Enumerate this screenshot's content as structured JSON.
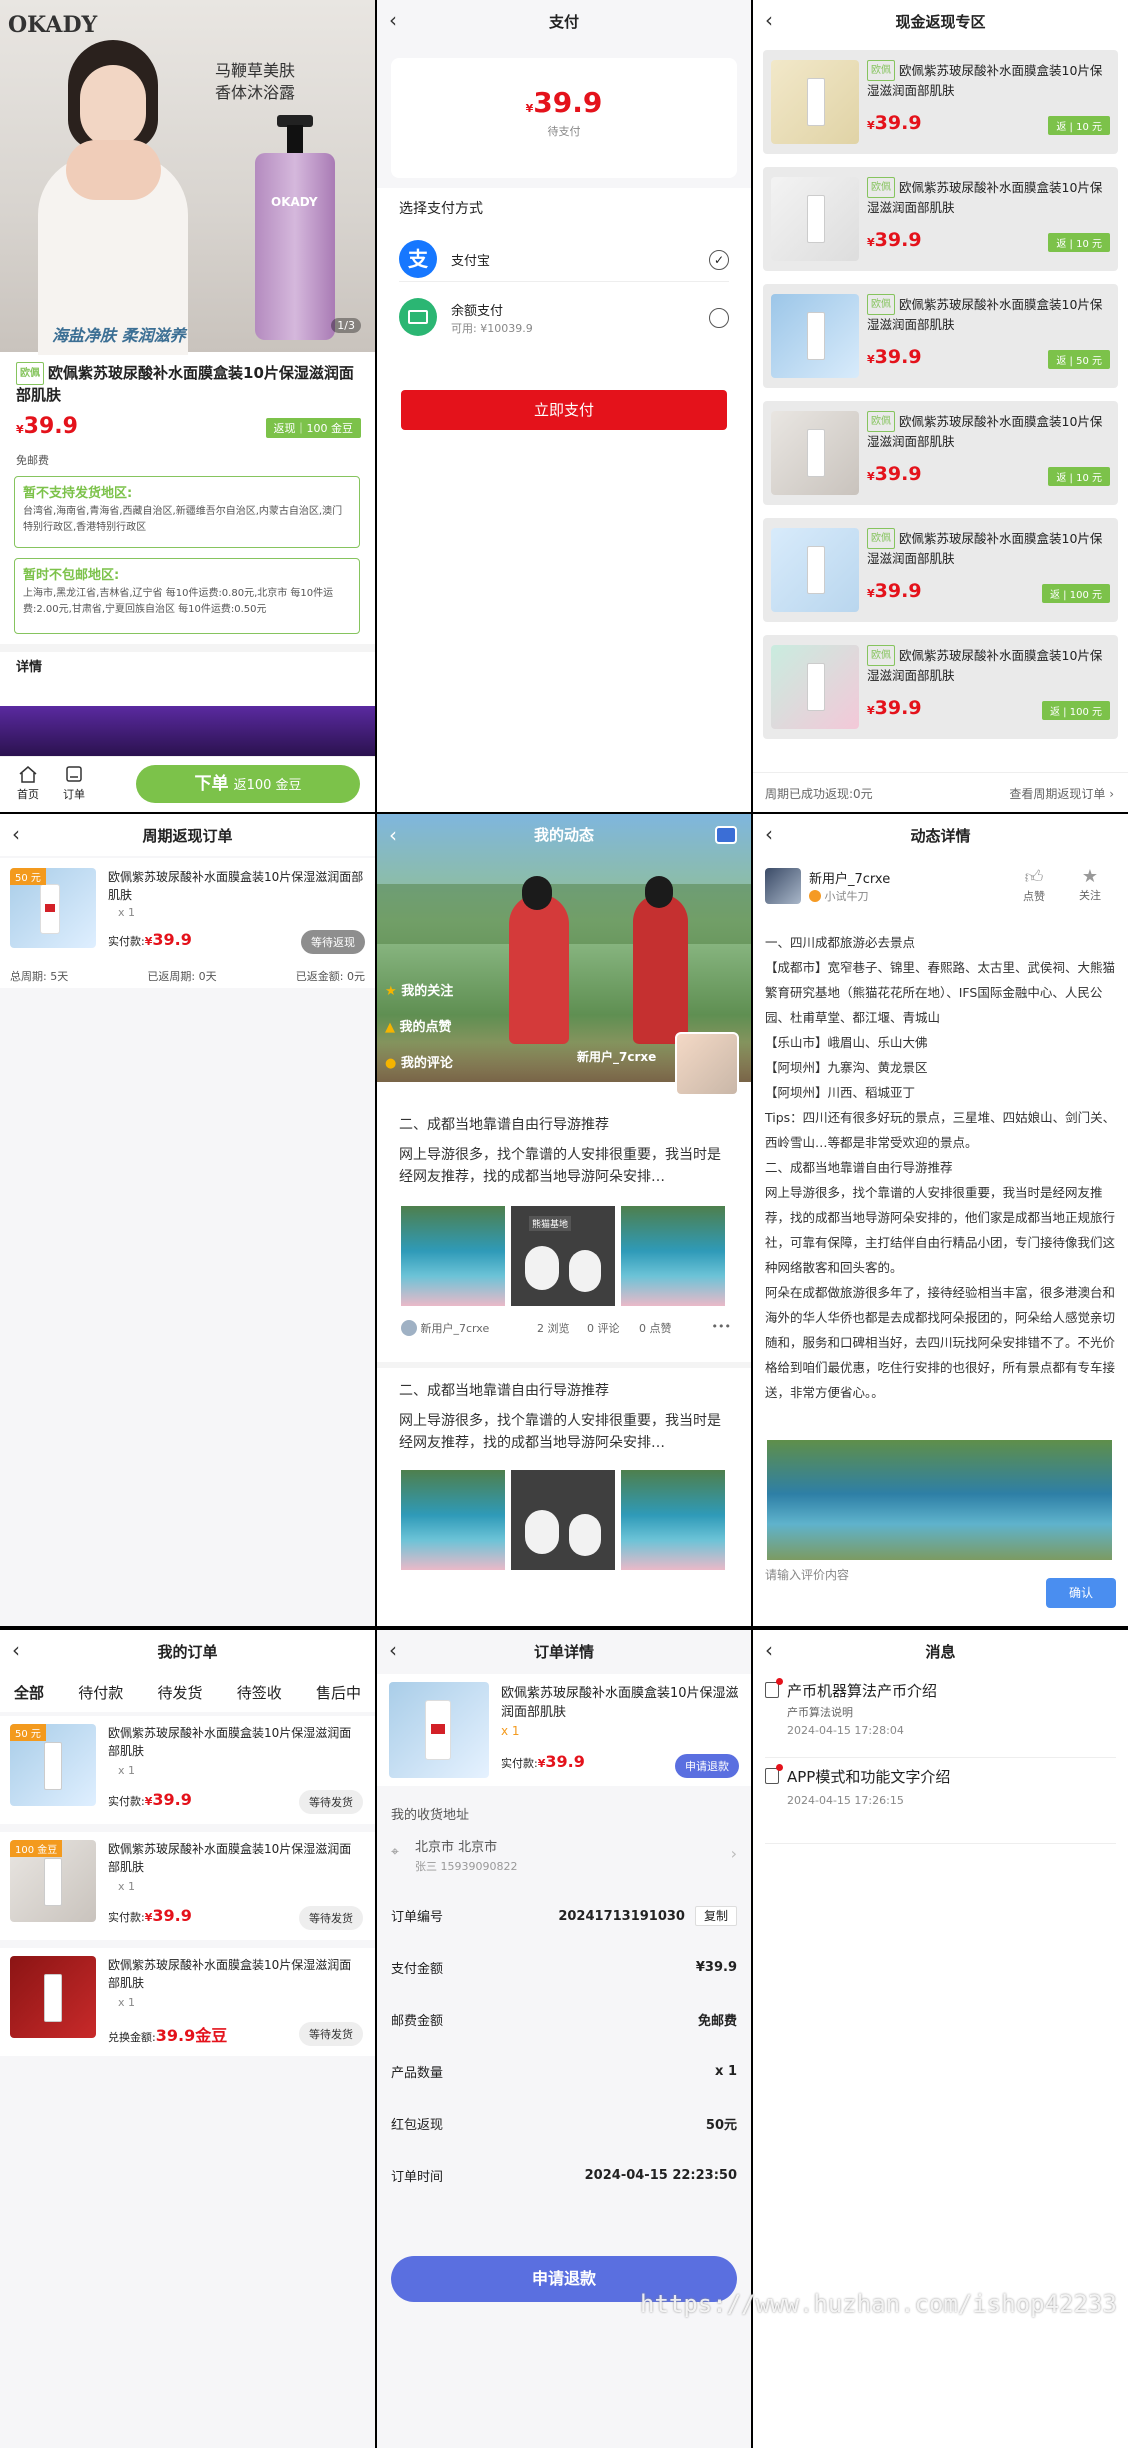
{
  "product": {
    "name": "欧佩紫苏玻尿酸补水面膜盒装10片保湿滋润面部肌肤",
    "tag": "欧佩",
    "brand": "OKADY",
    "ad_line1": "马鞭草美肤",
    "ad_line2": "香体沐浴露",
    "ad_slogan": "海盐净肤 柔润滋养",
    "image_counter": "1/3",
    "price_symbol": "¥",
    "price": "39.9",
    "rebate_badge": "返现｜100 金豆",
    "shipping": "免邮费",
    "no_ship_title": "暂不支持发货地区:",
    "no_ship_text": "台湾省,海南省,青海省,西藏自治区,新疆维吾尔自治区,内蒙古自治区,澳门特别行政区,香港特别行政区",
    "no_free_title": "暂时不包邮地区:",
    "no_free_text": "上海市,黑龙江省,吉林省,辽宁省 每10件运费:0.80元,北京市 每10件运费:2.00元,甘肃省,宁夏回族自治区 每10件运费:0.50元",
    "details_label": "详情",
    "tab_home": "首页",
    "tab_orders": "订单",
    "order_button_main": "下单",
    "order_button_sub": "返100 金豆"
  },
  "payment": {
    "title": "支付",
    "amount": "39.9",
    "status": "待支付",
    "method_label": "选择支付方式",
    "alipay": "支付宝",
    "balance": "余额支付",
    "balance_available": "可用: ¥10039.9",
    "pay_button": "立即支付"
  },
  "cashback": {
    "title": "现金返现专区",
    "items": [
      {
        "name": "欧佩紫苏玻尿酸补水面膜盒装10片保湿滋润面部肌肤",
        "price": "39.9",
        "badge": "返 | 10 元"
      },
      {
        "name": "欧佩紫苏玻尿酸补水面膜盒装10片保湿滋润面部肌肤",
        "price": "39.9",
        "badge": "返 | 10 元"
      },
      {
        "name": "欧佩紫苏玻尿酸补水面膜盒装10片保湿滋润面部肌肤",
        "price": "39.9",
        "badge": "返 | 50 元"
      },
      {
        "name": "欧佩紫苏玻尿酸补水面膜盒装10片保湿滋润面部肌肤",
        "price": "39.9",
        "badge": "返 | 10 元"
      },
      {
        "name": "欧佩紫苏玻尿酸补水面膜盒装10片保湿滋润面部肌肤",
        "price": "39.9",
        "badge": "返 | 100 元"
      },
      {
        "name": "欧佩紫苏玻尿酸补水面膜盒装10片保湿滋润面部肌肤",
        "price": "39.9",
        "badge": "返 | 100 元"
      }
    ],
    "footer_left": "周期已成功返现:0元",
    "footer_right": "查看周期返现订单"
  },
  "periodic": {
    "title": "周期返现订单",
    "badge": "50 元",
    "name": "欧佩紫苏玻尿酸补水面膜盒装10片保湿滋润面部肌肤",
    "qty": "x 1",
    "paid_label": "实付款:",
    "price": "39.9",
    "status": "等待返现",
    "total_period": "总周期: 5天",
    "returned_period": "已返周期: 0天",
    "returned_beans": "已返金额: 0元"
  },
  "moments": {
    "title": "我的动态",
    "menu_follow": "我的关注",
    "menu_likes": "我的点赞",
    "menu_comments": "我的评论",
    "user": "新用户_7crxe",
    "post1_title": "二、成都当地靠谱自由行导游推荐",
    "post1_text": "网上导游很多，找个靠谱的人安排很重要，我当时是经网友推荐，找的成都当地导游阿朵安排…",
    "post1_author": "新用户_7crxe",
    "post1_views": "2 浏览",
    "post1_comments": "0 评论",
    "post1_likes": "0 点赞",
    "post2_title": "二、成都当地靠谱自由行导游推荐",
    "post2_text": "网上导游很多，找个靠谱的人安排很重要，我当时是经网友推荐，找的成都当地导游阿朵安排…",
    "sign_text": "熊猫基地"
  },
  "detail": {
    "title": "动态详情",
    "user": "新用户_7crxe",
    "sub": "小试牛刀",
    "like": "点赞",
    "follow": "关注",
    "lines": [
      "一、四川成都旅游必去景点",
      "【成都市】宽窄巷子、锦里、春熙路、太古里、武侯祠、大熊猫繁育研究基地（熊猫花花所在地）、IFS国际金融中心、人民公园、杜甫草堂、都江堰、青城山",
      "【乐山市】峨眉山、乐山大佛",
      "【阿坝州】九寨沟、黄龙景区",
      "【阿坝州】川西、稻城亚丁",
      "Tips：四川还有很多好玩的景点，三星堆、四姑娘山、剑门关、西岭雪山…等都是非常受欢迎的景点。",
      "二、成都当地靠谱自由行导游推荐",
      "网上导游很多，找个靠谱的人安排很重要，我当时是经网友推荐，找的成都当地导游阿朵安排的，他们家是成都当地正规旅行社，可靠有保障，主打结伴自由行精品小团，专门接待像我们这种网络散客和回头客的。",
      "阿朵在成都做旅游很多年了，接待经验相当丰富，很多港澳台和海外的华人华侨也都是去成都找阿朵报团的，阿朵给人感觉亲切随和，服务和口碑相当好，去四川玩找阿朵安排错不了。不光价格给到咱们最优惠，吃住行安排的也很好，所有景点都有专车接送，非常方便省心。。"
    ],
    "comment_placeholder": "请输入评价内容",
    "confirm": "确认"
  },
  "orders": {
    "title": "我的订单",
    "tabs": [
      "全部",
      "待付款",
      "待发货",
      "待签收",
      "售后中"
    ],
    "items": [
      {
        "badge": "50 元",
        "name": "欧佩紫苏玻尿酸补水面膜盒装10片保湿滋润面部肌肤",
        "qty": "x 1",
        "paid_label": "实付款:",
        "price": "39.9",
        "status": "等待发货"
      },
      {
        "badge": "100 金豆",
        "name": "欧佩紫苏玻尿酸补水面膜盒装10片保湿滋润面部肌肤",
        "qty": "x 1",
        "paid_label": "实付款:",
        "price": "39.9",
        "status": "等待发货"
      },
      {
        "badge": "",
        "name": "欧佩紫苏玻尿酸补水面膜盒装10片保湿滋润面部肌肤",
        "qty": "x 1",
        "paid_label": "兑换金额:",
        "price": "39.9金豆",
        "status": "等待发货"
      }
    ]
  },
  "order_detail": {
    "title": "订单详情",
    "name": "欧佩紫苏玻尿酸补水面膜盒装10片保湿滋润面部肌肤",
    "qty": "x 1",
    "paid_label": "实付款:",
    "price": "39.9",
    "refund_small": "申请退款",
    "address_label": "我的收货地址",
    "address_city": "北京市 北京市",
    "address_contact": "张三 15939090822",
    "order_no_label": "订单编号",
    "order_no": "20241713191030",
    "copy": "复制",
    "pay_amount_label": "支付金额",
    "pay_amount": "¥39.9",
    "postage_label": "邮费金额",
    "postage": "免邮费",
    "qty_label": "产品数量",
    "qty_value": "x 1",
    "redpack_label": "红包返现",
    "redpack": "50元",
    "time_label": "订单时间",
    "time": "2024-04-15 22:23:50",
    "refund_button": "申请退款"
  },
  "messages": {
    "title": "消息",
    "items": [
      {
        "title": "产币机器算法产币介绍",
        "sub": "产币算法说明",
        "time": "2024-04-15 17:28:04"
      },
      {
        "title": "APP模式和功能文字介绍",
        "sub": "",
        "time": "2024-04-15 17:26:15"
      }
    ]
  },
  "watermark": "https://www.huzhan.com/ishop42233",
  "colors": {
    "red": "#e4121b",
    "green": "#7cc24a",
    "blue": "#5a6fe0",
    "purple": "#3d1d7a"
  }
}
